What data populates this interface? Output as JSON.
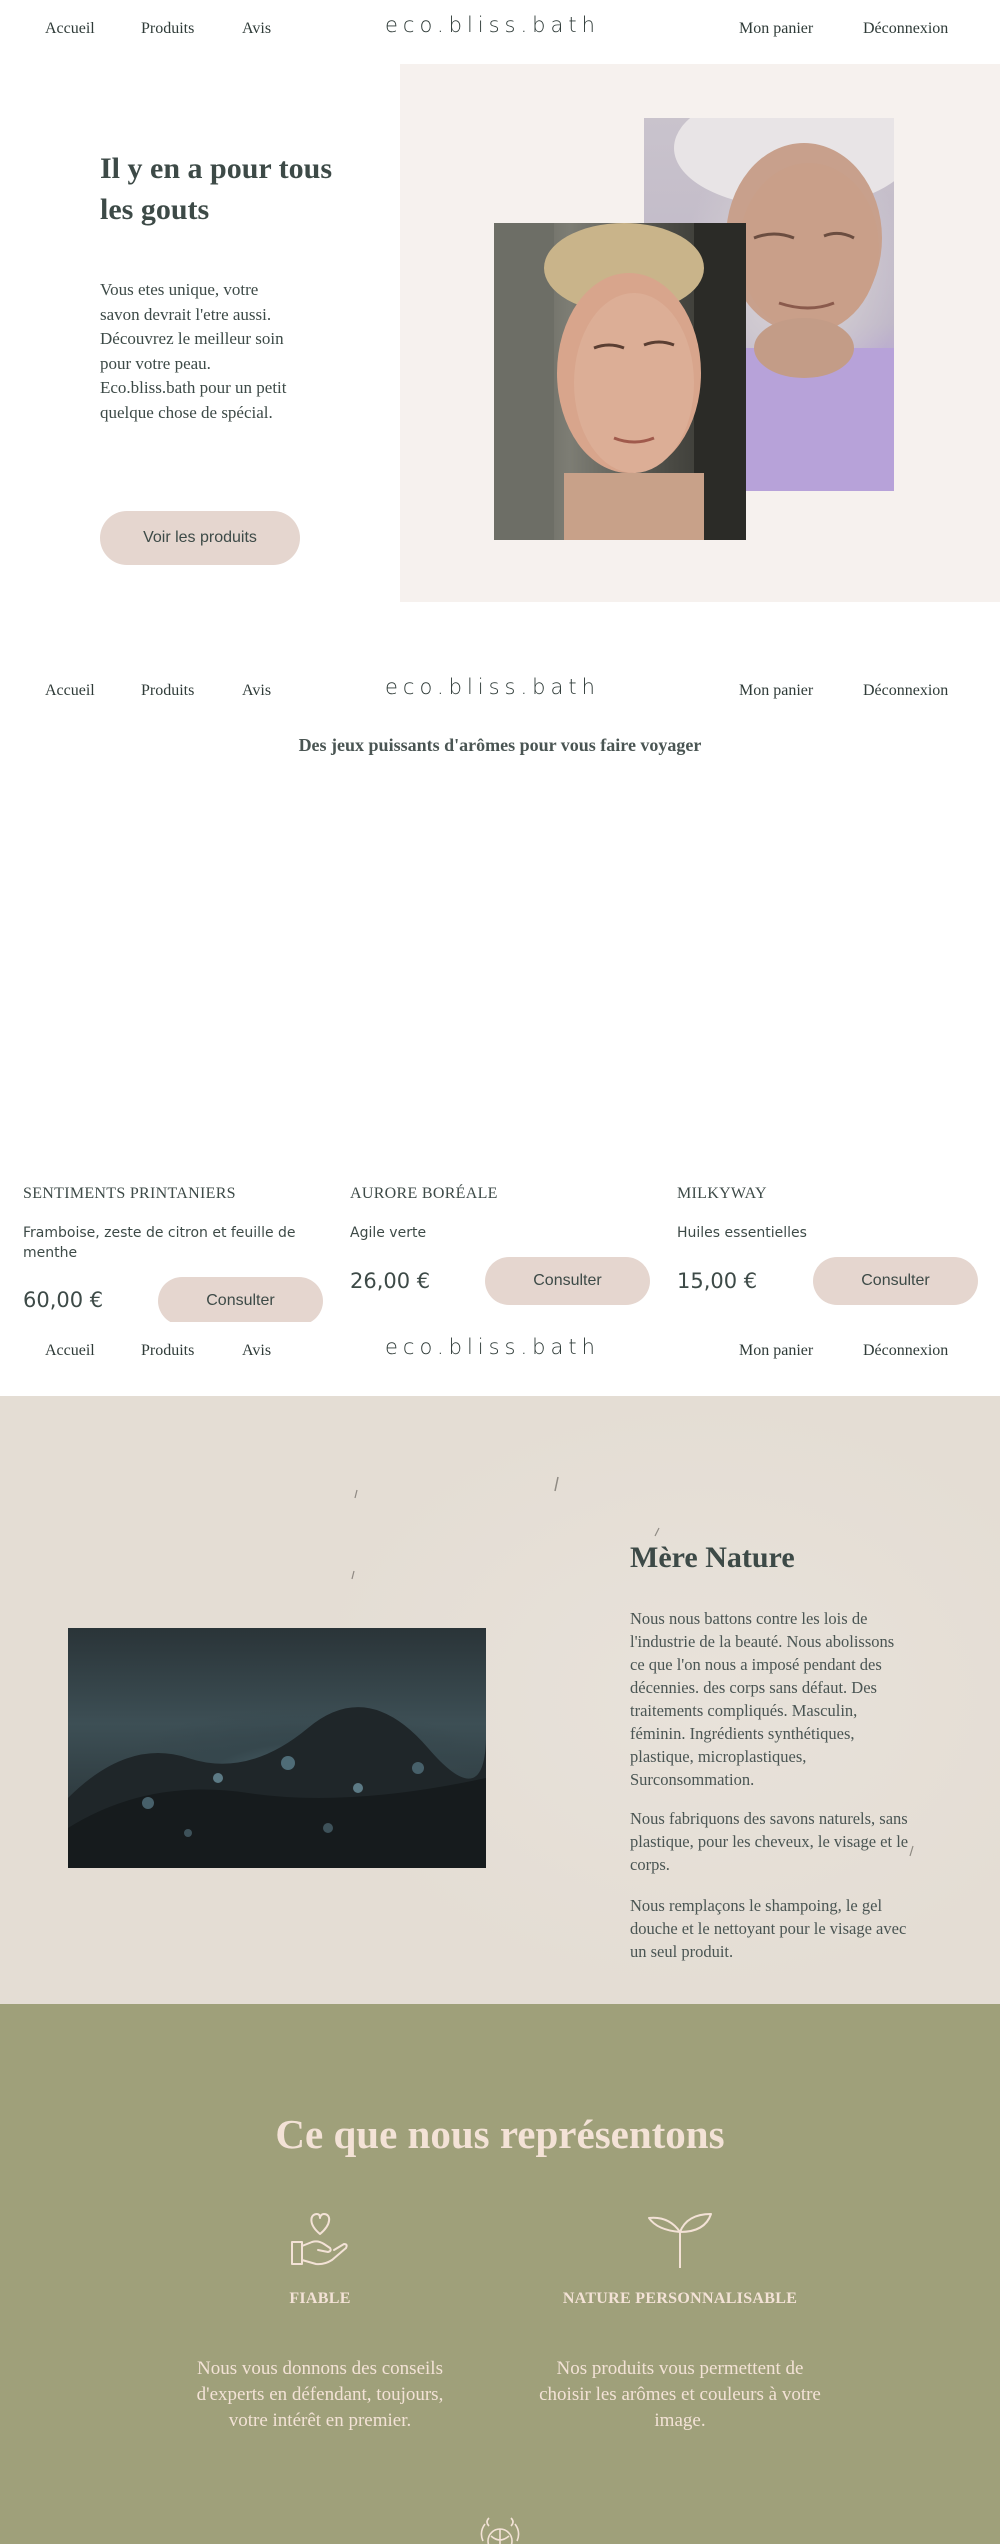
{
  "nav": {
    "home": "Accueil",
    "products": "Produits",
    "reviews": "Avis",
    "logo": "eco.bliss.bath",
    "cart": "Mon panier",
    "logout": "Déconnexion"
  },
  "hero": {
    "title": "Il y en a pour tous les gouts",
    "text": "Vous etes unique, votre savon devrait l'etre aussi. Découvrez le meilleur soin pour votre peau. Eco.bliss.bath pour un petit quelque chose de spécial.",
    "cta": "Voir les produits"
  },
  "products_section": {
    "subtitle": "Des jeux puissants d'arômes pour vous faire voyager",
    "items": [
      {
        "name": "SENTIMENTS PRINTANIERS",
        "desc": "Framboise, zeste de citron et feuille de menthe",
        "price": "60,00 €",
        "button": "Consulter"
      },
      {
        "name": "AURORE BORÉALE",
        "desc": "Agile verte",
        "price": "26,00 €",
        "button": "Consulter"
      },
      {
        "name": "MILKYWAY",
        "desc": "Huiles essentielles",
        "price": "15,00 €",
        "button": "Consulter"
      }
    ]
  },
  "nature": {
    "title": "Mère Nature",
    "p1": "Nous nous battons contre les lois de l'industrie de la beauté. Nous abolissons ce que l'on nous a imposé pendant des décennies. des corps sans défaut. Des traitements compliqués. Masculin, féminin. Ingrédients synthétiques, plastique, microplastiques, Surconsommation.",
    "p2": "Nous fabriquons des savons naturels, sans plastique, pour les cheveux, le visage et le corps.",
    "p3": "Nous remplaçons le shampoing, le gel douche et le nettoyant pour le visage avec un seul produit."
  },
  "values": {
    "title": "Ce que nous représentons",
    "items": [
      {
        "icon": "heart-hand-icon",
        "label": "FIABLE",
        "text": "Nous vous donnons des conseils d'experts en défendant, toujours, votre intérêt en premier."
      },
      {
        "icon": "sprout-icon",
        "label": "NATURE PERSONNALISABLE",
        "text": "Nos produits vous permettent de choisir les arômes et couleurs à votre image."
      }
    ]
  },
  "colors": {
    "accent_pill": "#e5d6cf",
    "values_bg": "#9fa07a",
    "values_text": "#f3e2d6",
    "hero_bg": "#f6f1ee"
  }
}
